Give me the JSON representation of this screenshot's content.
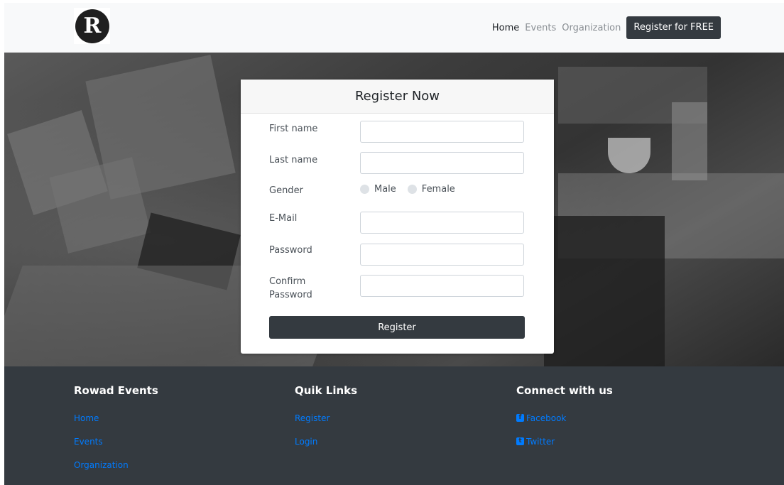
{
  "brand": {
    "logo_letter": "R"
  },
  "nav": {
    "items": [
      {
        "label": "Home",
        "active": true
      },
      {
        "label": "Events",
        "active": false
      },
      {
        "label": "Organization",
        "active": false
      }
    ],
    "cta_label": "Register for FREE"
  },
  "form": {
    "title": "Register Now",
    "first_name_label": "First name",
    "first_name_value": "",
    "last_name_label": "Last name",
    "last_name_value": "",
    "gender_label": "Gender",
    "gender_options": [
      "Male",
      "Female"
    ],
    "email_label": "E-Mail",
    "email_value": "",
    "password_label": "Password",
    "confirm_label_line1": "Confirm",
    "confirm_label_line2": "Password",
    "submit_label": "Register"
  },
  "footer": {
    "col1": {
      "title": "Rowad Events",
      "links": [
        "Home",
        "Events",
        "Organization"
      ]
    },
    "col2": {
      "title": "Quik Links",
      "links": [
        "Register",
        "Login"
      ]
    },
    "col3": {
      "title": "Connect with us",
      "links": [
        "Facebook",
        "Twitter"
      ]
    }
  },
  "colors": {
    "dark": "#343a40",
    "link": "#007bff",
    "navbar_bg": "#f8f9fa"
  },
  "icons": {
    "facebook": "facebook-icon",
    "twitter": "twitter-icon"
  }
}
